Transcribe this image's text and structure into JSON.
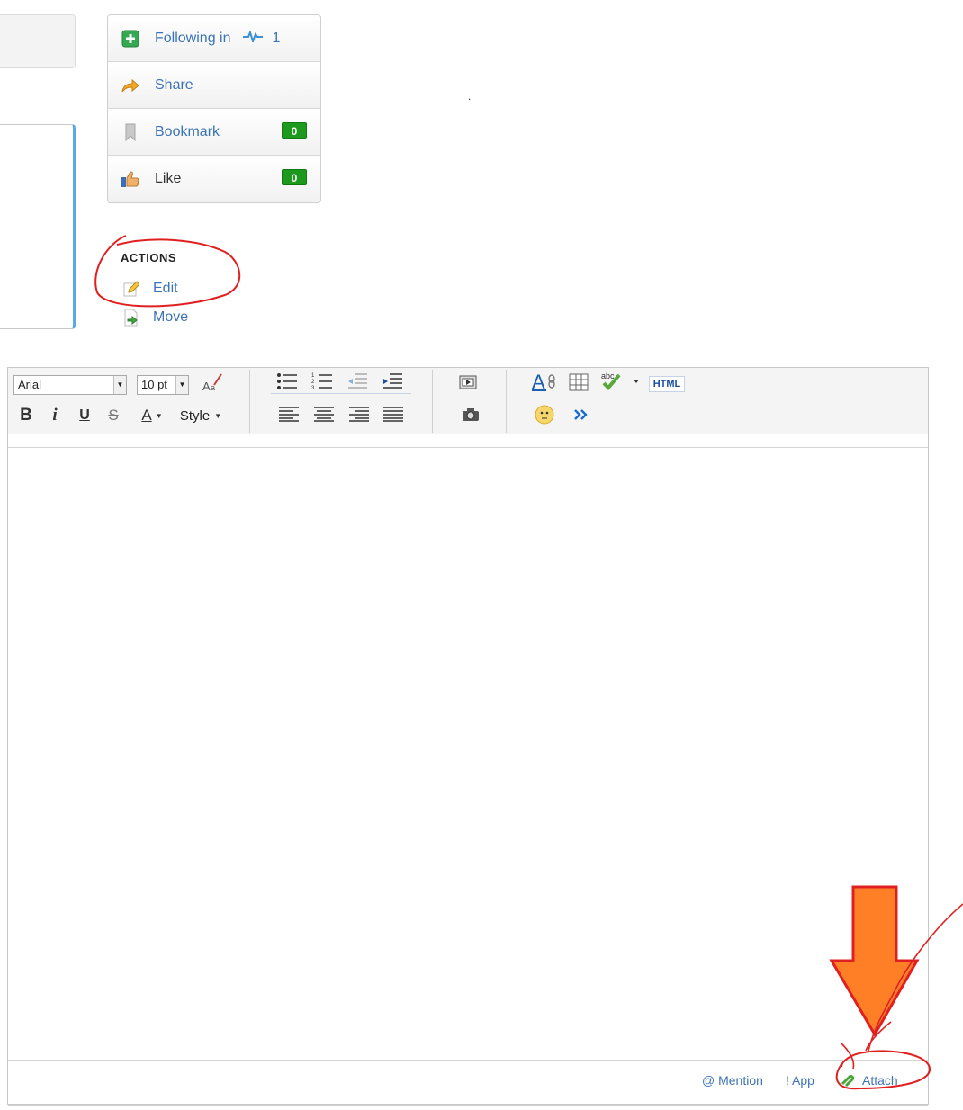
{
  "social": {
    "following_label": "Following in",
    "following_count": "1",
    "share_label": "Share",
    "bookmark_label": "Bookmark",
    "bookmark_count": "0",
    "like_label": "Like",
    "like_count": "0"
  },
  "stray_dot": ".",
  "actions": {
    "title": "ACTIONS",
    "edit_label": "Edit",
    "move_label": "Move"
  },
  "editor": {
    "font_family": "Arial",
    "font_size": "10 pt",
    "style_label": "Style",
    "html_label": "HTML",
    "bold": "B",
    "italic": "i",
    "underline": "U",
    "strike": "S",
    "text_color": "A",
    "content": ""
  },
  "footer": {
    "mention": "@ Mention",
    "app": "! App",
    "attach": "Attach"
  },
  "icons": {
    "follow": "plus-icon",
    "activity": "activity-icon",
    "share": "share-arrow-icon",
    "bookmark": "bookmark-icon",
    "like": "thumbs-up-icon",
    "edit": "pencil-icon",
    "move": "move-arrow-icon",
    "attach": "paperclip-icon"
  },
  "colors": {
    "link": "#3b73b9",
    "count_badge": "#1d9a1d",
    "annotation_red": "#e02020",
    "annotation_arrow": "#ff7f27"
  }
}
